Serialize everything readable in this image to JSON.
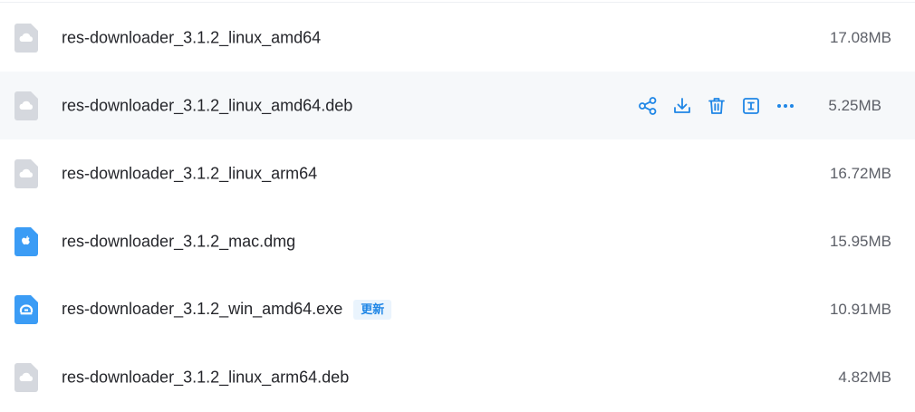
{
  "files": [
    {
      "name": "res-downloader_3.1.2_linux_amd64",
      "size": "17.08MB",
      "icon": "cloud-file-icon",
      "badge": ""
    },
    {
      "name": "res-downloader_3.1.2_linux_amd64.deb",
      "size": "5.25MB",
      "icon": "cloud-file-icon",
      "badge": ""
    },
    {
      "name": "res-downloader_3.1.2_linux_arm64",
      "size": "16.72MB",
      "icon": "cloud-file-icon",
      "badge": ""
    },
    {
      "name": "res-downloader_3.1.2_mac.dmg",
      "size": "15.95MB",
      "icon": "apple-file-icon",
      "badge": ""
    },
    {
      "name": "res-downloader_3.1.2_win_amd64.exe",
      "size": "10.91MB",
      "icon": "exe-file-icon",
      "badge": "更新"
    },
    {
      "name": "res-downloader_3.1.2_linux_arm64.deb",
      "size": "4.82MB",
      "icon": "cloud-file-icon",
      "badge": ""
    }
  ],
  "row_actions": [
    "share-icon",
    "download-icon",
    "delete-icon",
    "rename-icon",
    "more-icon"
  ],
  "colors": {
    "accent": "#1f86e6",
    "hover_bg": "#f6f8fa",
    "gray_icon": "#d5d8de",
    "blue_icon": "#3b9cf5"
  }
}
